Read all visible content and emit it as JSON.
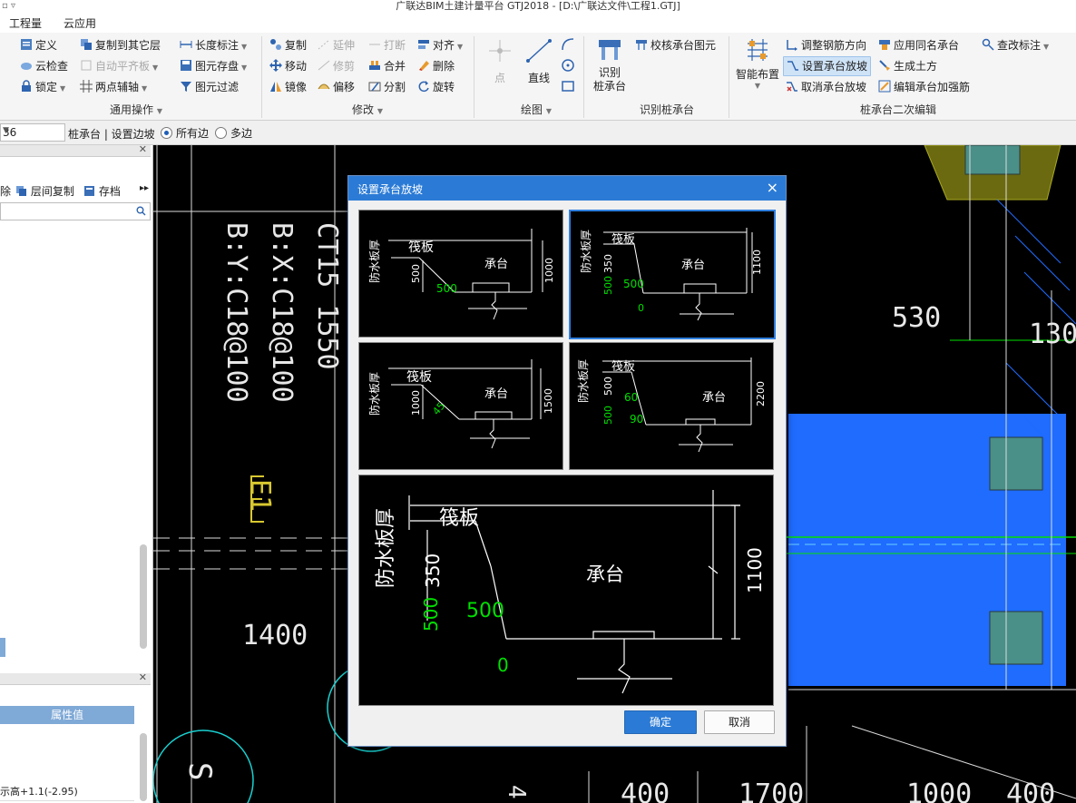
{
  "window": {
    "title": "广联达BIM土建计量平台 GTJ2018 - [D:\\广联达文件\\工程1.GTJ]",
    "quick_access": "▫ ▿"
  },
  "menu": {
    "items": [
      "工程量",
      "云应用"
    ]
  },
  "ribbon": {
    "general": {
      "define": "定义",
      "copy_to_floor": "复制到其它层",
      "length_dim": "长度标注",
      "cloud_check": "云检查",
      "auto_flat": "自动平齐板",
      "save_to_disk": "图元存盘",
      "lock": "锁定",
      "two_point_axis": "两点辅轴",
      "filter": "图元过滤",
      "group_label": "通用操作"
    },
    "modify": {
      "copy": "复制",
      "extend": "延伸",
      "break": "打断",
      "align": "对齐",
      "move": "移动",
      "trim": "修剪",
      "merge": "合并",
      "delete": "删除",
      "mirror": "镜像",
      "offset": "偏移",
      "split": "分割",
      "rotate": "旋转",
      "group_label": "修改"
    },
    "draw": {
      "point": "点",
      "line": "直线",
      "group_label": "绘图"
    },
    "identify": {
      "identify_cap": "识别\n桩承台",
      "check_cap": "校核承台图元",
      "group_label": "识别桩承台"
    },
    "secondary": {
      "smart_layout": "智能布置",
      "adjust_rebar": "调整钢筋方向",
      "apply_same": "应用同名承台",
      "check_mark": "查改标注",
      "set_slope": "设置承台放坡",
      "gen_earth": "生成土方",
      "cancel_slope": "取消承台放坡",
      "edit_strengthen": "编辑承台加强筋",
      "group_label": "桩承台二次编辑"
    }
  },
  "context_bar": {
    "combo_value": "36",
    "breadcrumb": "桩承台 | 设置边坡",
    "radio_all": "所有边",
    "radio_multi": "多边"
  },
  "left_panel": {
    "tools": {
      "remove": "除",
      "floor_copy": "层间复制",
      "archive": "存档"
    },
    "prop_header": "属性值",
    "prop_row_last": "示高+1.1(-2.95)"
  },
  "cad": {
    "labels": {
      "ct": "CT15 1550",
      "bx": "B:X:C18@100",
      "by": "B:Y:C18@100",
      "e1": "E1",
      "d1400": "1400",
      "d530": "530",
      "d130": "130",
      "d400a": "400",
      "d1700": "1700",
      "d1000": "1000",
      "d400b": "400",
      "d4": "4",
      "s": "S"
    }
  },
  "dialog": {
    "title": "设置承台放坡",
    "close": "×",
    "thumbs": [
      {
        "vertical": "防水板厚",
        "raft": "筏板",
        "cap": "承台",
        "h1": "500",
        "h2": "1000",
        "slope": "500"
      },
      {
        "vertical": "防水板厚",
        "raft": "筏板",
        "cap": "承台",
        "h1": "350",
        "h1b": "500",
        "h2": "1100",
        "slope": "500",
        "bottom": "0"
      },
      {
        "vertical": "防水板厚",
        "raft": "筏板",
        "cap": "承台",
        "h1": "1000",
        "h2": "1500",
        "angle": "45"
      },
      {
        "vertical": "防水板厚",
        "raft": "筏板",
        "cap": "承台",
        "h1": "500",
        "h1b": "500",
        "h2": "2200",
        "a1": "60",
        "a2": "90"
      }
    ],
    "preview": {
      "vertical": "防水板厚",
      "raft": "筏板",
      "cap": "承台",
      "h1": "350",
      "h1b": "500",
      "h2": "1100",
      "slope": "500",
      "bottom": "0"
    },
    "ok": "确定",
    "cancel": "取消"
  },
  "colors": {
    "accent": "#2b7bd6",
    "cad_green": "#00e000",
    "cad_blue": "#1f6cff"
  }
}
